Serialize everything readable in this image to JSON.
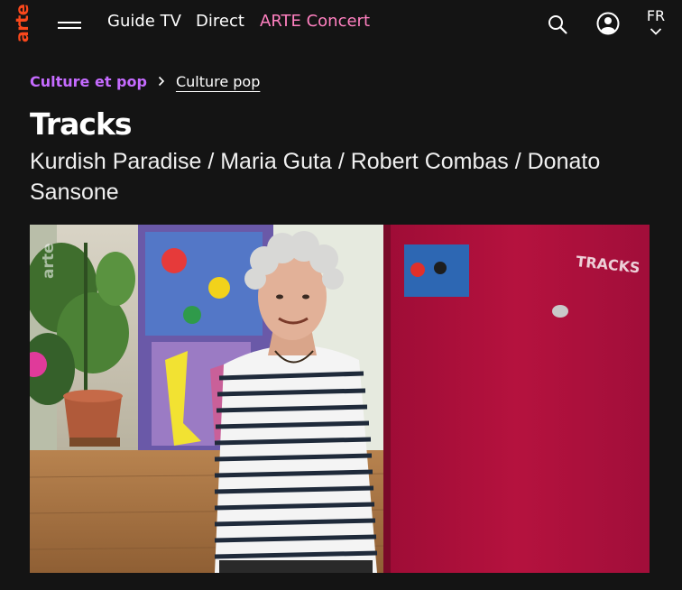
{
  "header": {
    "logo_text": "arte",
    "menu_icon": "hamburger-menu-icon",
    "nav": [
      {
        "label": "Guide TV"
      },
      {
        "label": "Direct"
      },
      {
        "label": "ARTE Concert"
      }
    ],
    "search_icon": "search-icon",
    "account_icon": "user-account-icon",
    "language": {
      "code": "FR",
      "icon": "chevron-down-icon"
    }
  },
  "breadcrumb": {
    "items": [
      {
        "label": "Culture et pop"
      },
      {
        "label": "Culture pop"
      }
    ],
    "separator_icon": "chevron-right-icon"
  },
  "program": {
    "title": "Tracks",
    "subtitle": "Kurdish Paradise / Maria Guta / Robert Combas / Donato Sansone"
  },
  "video": {
    "watermark_left": "arte",
    "watermark_right": "TRACKS"
  },
  "colors": {
    "background": "#141414",
    "logo": "#fa481c",
    "concert_accent": "#ff80c0",
    "breadcrumb_accent": "#c56bff",
    "door": "#b0103a"
  }
}
